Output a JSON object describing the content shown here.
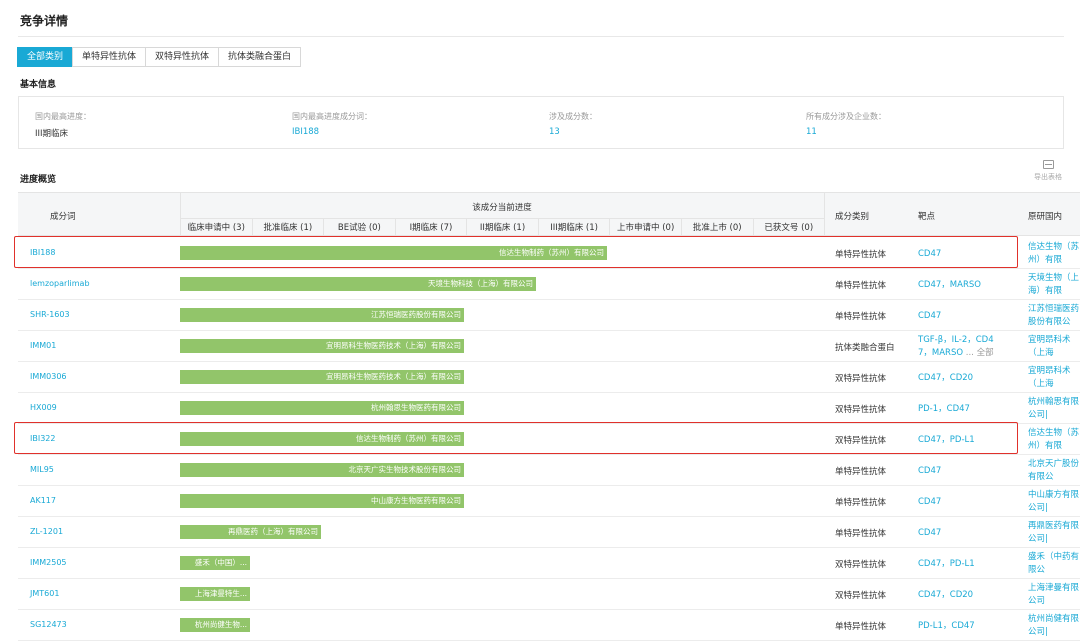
{
  "page": {
    "title": "竞争详情"
  },
  "tabs": [
    "全部类别",
    "单特异性抗体",
    "双特异性抗体",
    "抗体类融合蛋白"
  ],
  "basic": {
    "label": "基本信息",
    "fields": [
      {
        "label": "国内最高进度：",
        "value": "III期临床",
        "link": false
      },
      {
        "label": "国内最高进度成分词：",
        "value": "IBI188",
        "link": true
      },
      {
        "label": "涉及成分数：",
        "value": "13",
        "link": true
      },
      {
        "label": "所有成分涉及企业数：",
        "value": "11",
        "link": true
      }
    ]
  },
  "progress": {
    "label": "进度概览",
    "export_label": "导出表格"
  },
  "table": {
    "headers": {
      "ingredient": "成分词",
      "progress": "该成分当前进度",
      "type": "成分类别",
      "target": "靶点",
      "org": "原研国内"
    },
    "stages": [
      "临床申请中 (3)",
      "批准临床 (1)",
      "BE试验 (0)",
      "I期临床 (7)",
      "II期临床 (1)",
      "III期临床 (1)",
      "上市申请中 (0)",
      "批准上市 (0)",
      "已获文号 (0)"
    ],
    "rows": [
      {
        "code": "IBI188",
        "company": "信达生物制药（苏州）有限公司",
        "stage_reached": 6,
        "type": "单特异性抗体",
        "target_lines": [
          "CD47"
        ],
        "more": "",
        "org": "信达生物（苏州）有限"
      },
      {
        "code": "lemzoparlimab",
        "company": "天境生物科技（上海）有限公司",
        "stage_reached": 5,
        "type": "单特异性抗体",
        "target_lines": [
          "CD47，MARSO"
        ],
        "more": "",
        "org": "天境生物（上海）有限"
      },
      {
        "code": "SHR-1603",
        "company": "江苏恒瑞医药股份有限公司",
        "stage_reached": 4,
        "type": "单特异性抗体",
        "target_lines": [
          "CD47"
        ],
        "more": "",
        "org": "江苏恒瑞医药股份有限公司|"
      },
      {
        "code": "IMM01",
        "company": "宜明昂科生物医药技术（上海）有限公司",
        "stage_reached": 4,
        "type": "抗体类融合蛋白",
        "target_lines": [
          "TGF-β，IL-2，CD4",
          "7，MARSO"
        ],
        "more": "... 全部",
        "org": "宜明昂科术（上海"
      },
      {
        "code": "IMM0306",
        "company": "宜明昂科生物医药技术（上海）有限公司",
        "stage_reached": 4,
        "type": "双特异性抗体",
        "target_lines": [
          "CD47，CD20"
        ],
        "more": "",
        "org": "宜明昂科术（上海"
      },
      {
        "code": "HX009",
        "company": "杭州翰思生物医药有限公司",
        "stage_reached": 4,
        "type": "双特异性抗体",
        "target_lines": [
          "PD-1，CD47"
        ],
        "more": "",
        "org": "杭州翰思有限公司|"
      },
      {
        "code": "IBI322",
        "company": "信达生物制药（苏州）有限公司",
        "stage_reached": 4,
        "type": "双特异性抗体",
        "target_lines": [
          "CD47，PD-L1"
        ],
        "more": "",
        "org": "信达生物（苏州）有限"
      },
      {
        "code": "MIL95",
        "company": "北京天广实生物技术股份有限公司",
        "stage_reached": 4,
        "type": "单特异性抗体",
        "target_lines": [
          "CD47"
        ],
        "more": "",
        "org": "北京天广股份有限公"
      },
      {
        "code": "AK117",
        "company": "中山康方生物医药有限公司",
        "stage_reached": 4,
        "type": "单特异性抗体",
        "target_lines": [
          "CD47"
        ],
        "more": "",
        "org": "中山康方有限公司|"
      },
      {
        "code": "ZL-1201",
        "company": "再鼎医药（上海）有限公司",
        "stage_reached": 2,
        "type": "单特异性抗体",
        "target_lines": [
          "CD47"
        ],
        "more": "",
        "org": "再鼎医药有限公司|"
      },
      {
        "code": "IMM2505",
        "company": "盛禾（中国）...",
        "stage_reached": 1,
        "type": "双特异性抗体",
        "target_lines": [
          "CD47，PD-L1"
        ],
        "more": "",
        "org": "盛禾（中药有限公"
      },
      {
        "code": "JMT601",
        "company": "上海津曼特生...",
        "stage_reached": 1,
        "type": "双特异性抗体",
        "target_lines": [
          "CD47，CD20"
        ],
        "more": "",
        "org": "上海津曼有限公司"
      },
      {
        "code": "SG12473",
        "company": "杭州尚健生物...",
        "stage_reached": 1,
        "type": "单特异性抗体",
        "target_lines": [
          "PD-L1，CD47"
        ],
        "more": "",
        "org": "杭州尚健有限公司|"
      }
    ],
    "highlighted_codes": [
      "IBI188",
      "IBI322"
    ],
    "highlight_color": "#e0312b",
    "bar_color": "#92c56a",
    "accent_color": "#19a9d5"
  }
}
